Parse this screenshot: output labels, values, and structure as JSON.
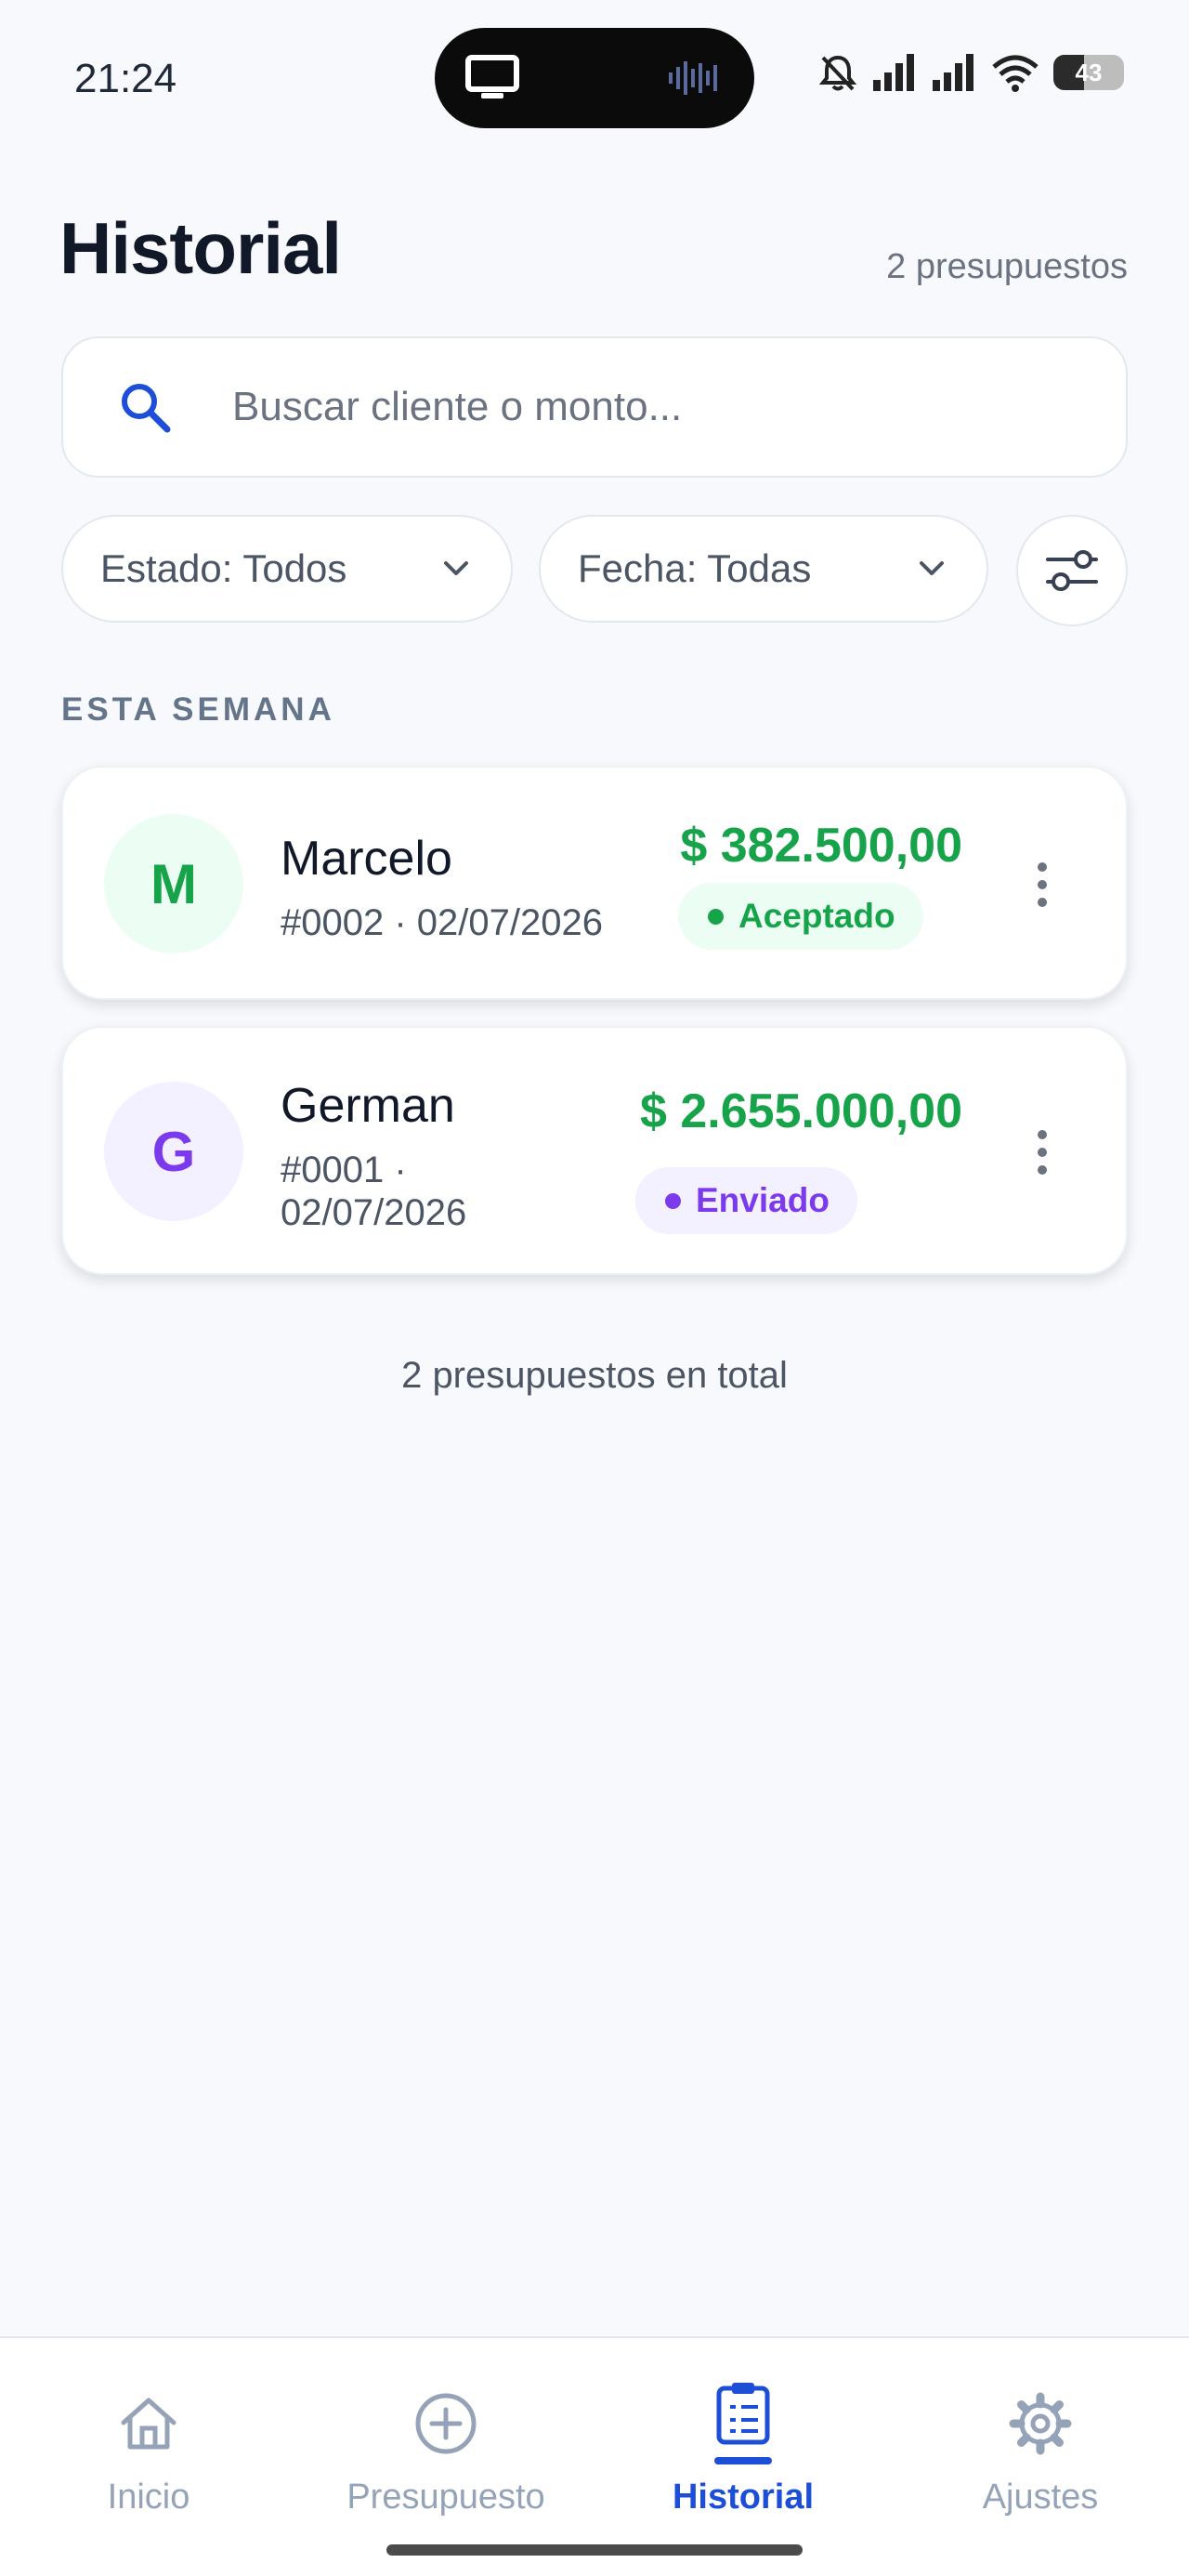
{
  "status_bar": {
    "time": "21:24",
    "battery_level": "43",
    "icons": [
      "tv-icon",
      "audio-bars-icon",
      "bell-off-icon",
      "signal-icon",
      "signal-icon",
      "wifi-icon",
      "battery-icon"
    ]
  },
  "header": {
    "title": "Historial",
    "count": "2 presupuestos"
  },
  "search": {
    "placeholder": "Buscar cliente o monto...",
    "icon": "search-icon"
  },
  "filters": {
    "estado_label": "Estado: Todos",
    "fecha_label": "Fecha: Todas",
    "settings_icon": "sliders-icon"
  },
  "section": {
    "label": "ESTA SEMANA"
  },
  "quotes": [
    {
      "initial": "M",
      "name": "Marcelo",
      "meta": "#0002 · 02/07/2026",
      "amount": "$ 382.500,00",
      "status": "Aceptado",
      "status_color": "#16a34a"
    },
    {
      "initial": "G",
      "name": "German",
      "meta": "#0001 · 02/07/2026",
      "amount": "$ 2.655.000,00",
      "status": "Enviado",
      "status_color": "#7c3aed"
    }
  ],
  "footer": {
    "total": "2 presupuestos en total"
  },
  "nav": {
    "items": [
      {
        "label": "Inicio",
        "icon": "home-icon"
      },
      {
        "label": "Presupuesto",
        "icon": "plus-circle-icon"
      },
      {
        "label": "Historial",
        "icon": "clipboard-list-icon",
        "active": true
      },
      {
        "label": "Ajustes",
        "icon": "gear-icon"
      }
    ]
  },
  "colors": {
    "accent": "#1d4ed8",
    "amount": "#16a34a",
    "background": "#f7f9fc"
  }
}
